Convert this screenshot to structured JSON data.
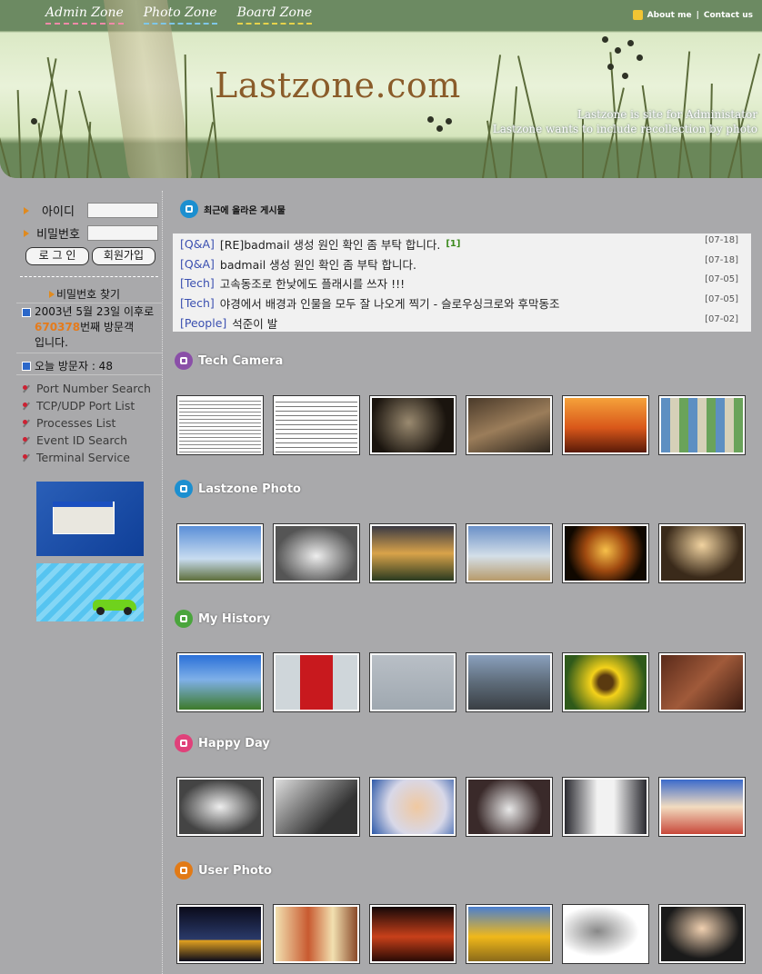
{
  "header": {
    "nav": [
      "Admin Zone",
      "Photo Zone",
      "Board Zone"
    ],
    "about": "About me",
    "separator": "|",
    "contact": "Contact us",
    "logo": "Lastzone.com",
    "tagline1": "Lastzone is site for Administator",
    "tagline2": "Lastzone wants to include recollection by photo"
  },
  "sidebar": {
    "id_label": "아이디",
    "pw_label": "비밀번호",
    "login_button": "로 그 인",
    "join_button": "회원가입",
    "find_pw": "비밀번호 찾기",
    "visit_prefix": "2003년 5월 23일 이후로",
    "visit_count": "670378",
    "visit_suffix": "번째 방문객",
    "visit_end": "입니다.",
    "today_visitors": "오늘 방문자 : 48",
    "links": [
      "Port Number Search",
      "TCP/UDP Port List",
      "Processes List",
      "Event ID Search",
      "Terminal Service"
    ]
  },
  "recent": {
    "title": "최근에 올라온 게시물",
    "posts": [
      {
        "cat": "[Q&A]",
        "title": "[RE]badmail 생성 원인 확인 좀 부탁 합니다.",
        "count": "[1]",
        "date": "[07-18]"
      },
      {
        "cat": "[Q&A]",
        "title": "badmail 생성 원인 확인 좀 부탁 합니다.",
        "count": "",
        "date": "[07-18]"
      },
      {
        "cat": "[Tech]",
        "title": "고속동조로 한낮에도 플래시를 쓰자 !!!",
        "count": "",
        "date": "[07-05]"
      },
      {
        "cat": "[Tech]",
        "title": "야경에서 배경과 인물을 모두 잘 나오게 찍기 - 슬로우싱크로와 후막동조",
        "count": "",
        "date": "[07-05]"
      },
      {
        "cat": "[People]",
        "title": "석준이 발",
        "count": "",
        "date": "[07-02]"
      }
    ]
  },
  "sections": [
    {
      "title": "Tech Camera",
      "icon": "camera-icon",
      "color": "#8a4fa8"
    },
    {
      "title": "Lastzone Photo",
      "icon": "photo-icon",
      "color": "#1c8fd0"
    },
    {
      "title": "My History",
      "icon": "car-icon",
      "color": "#4aa53c"
    },
    {
      "title": "Happy Day",
      "icon": "flower-icon",
      "color": "#e0417a"
    },
    {
      "title": "User Photo",
      "icon": "arrow-icon",
      "color": "#e27a16"
    }
  ]
}
